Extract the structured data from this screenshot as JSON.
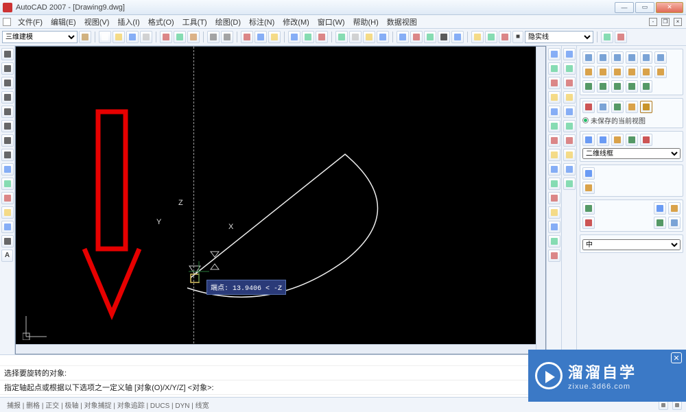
{
  "titlebar": {
    "title": "AutoCAD 2007 - [Drawing9.dwg]"
  },
  "menus": [
    "文件(F)",
    "编辑(E)",
    "视图(V)",
    "插入(I)",
    "格式(O)",
    "工具(T)",
    "绘图(D)",
    "标注(N)",
    "修改(M)",
    "窗口(W)",
    "帮助(H)",
    "数据视图"
  ],
  "workspace_selector": "三维建模",
  "linetype_selector": "隐实线",
  "panels": {
    "view": {
      "saved_label": "未保存的当前视图"
    },
    "visualstyle": {
      "value": "二维线框"
    },
    "layer": {
      "value": "中"
    }
  },
  "canvas": {
    "axis_x": "X",
    "axis_y": "Y",
    "axis_z": "Z",
    "tooltip_text": "端点: 13.9406 < -Z"
  },
  "cmd": {
    "line1": "选择要旋转的对象:",
    "line2": "指定轴起点或根据以下选项之一定义轴 [对象(O)/X/Y/Z] <对象>:"
  },
  "statusbar": {
    "toggles": "捕报 | 删格 | 正交 | 极轴 | 对象捕捉 | 对象追踪 | DUCS | DYN | 线宽"
  },
  "watermark": {
    "title": "溜溜自学",
    "url": "zixue.3d66.com"
  }
}
